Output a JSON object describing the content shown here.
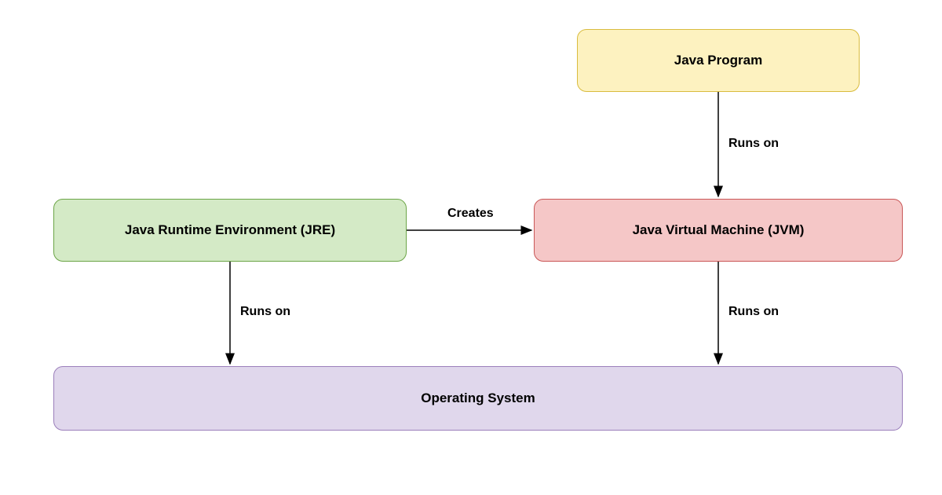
{
  "nodes": {
    "java_program": {
      "label": "Java Program"
    },
    "jre": {
      "label": "Java Runtime Environment (JRE)"
    },
    "jvm": {
      "label": "Java Virtual Machine (JVM)"
    },
    "os": {
      "label": "Operating System"
    }
  },
  "edges": {
    "program_to_jvm": {
      "label": "Runs on"
    },
    "jre_to_jvm": {
      "label": "Creates"
    },
    "jre_to_os": {
      "label": "Runs on"
    },
    "jvm_to_os": {
      "label": "Runs on"
    }
  },
  "colors": {
    "java_program_fill": "#fdf2c0",
    "java_program_border": "#d9bc3f",
    "jre_fill": "#d4eac6",
    "jre_border": "#6ca547",
    "jvm_fill": "#f5c7c7",
    "jvm_border": "#c95757",
    "os_fill": "#e0d7ec",
    "os_border": "#9b7fbb"
  }
}
